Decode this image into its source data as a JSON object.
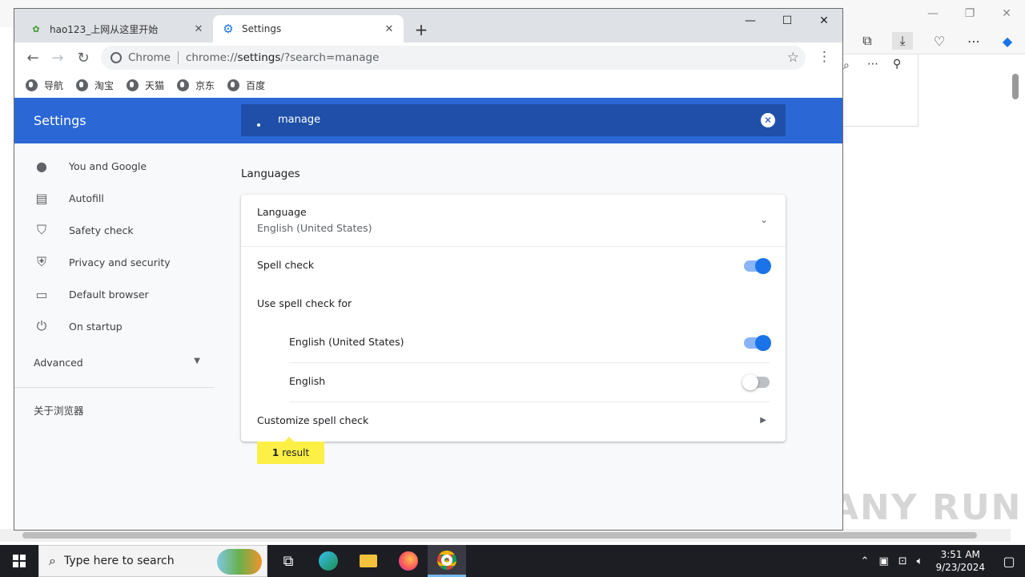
{
  "browser": {
    "tabs": [
      {
        "label": "hao123_上网从这里开始",
        "close": "✕"
      },
      {
        "label": "Settings",
        "close": "✕"
      }
    ],
    "new_tab": "+",
    "window_controls": {
      "minimize": "—",
      "maximize": "☐",
      "close": "✕"
    },
    "omnibox": {
      "chip": "Chrome",
      "url_prefix": "chrome://",
      "url_host": "settings",
      "url_rest": "/?search=manage"
    },
    "bookmarks": [
      "导航",
      "淘宝",
      "天猫",
      "京东",
      "百度"
    ]
  },
  "settings": {
    "title": "Settings",
    "search": {
      "value": "manage",
      "clear_icon": "✕"
    },
    "nav": [
      {
        "label": "You and Google",
        "icon": "person-icon"
      },
      {
        "label": "Autofill",
        "icon": "clipboard-icon"
      },
      {
        "label": "Safety check",
        "icon": "shield-check-icon"
      },
      {
        "label": "Privacy and security",
        "icon": "shield-icon"
      },
      {
        "label": "Default browser",
        "icon": "browser-icon"
      },
      {
        "label": "On startup",
        "icon": "power-icon"
      }
    ],
    "advanced": "Advanced",
    "about": "关于浏览器",
    "section_title": "Languages",
    "language": {
      "label": "Language",
      "value": "English (United States)"
    },
    "spell_check": {
      "label": "Spell check",
      "enabled": true
    },
    "use_spell_check_for": "Use spell check for",
    "spell_languages": [
      {
        "label": "English (United States)",
        "enabled": true
      },
      {
        "label": "English",
        "enabled": false
      }
    ],
    "customize": "Customize spell check",
    "result": {
      "count": "1",
      "label": "result"
    }
  },
  "taskbar": {
    "search_placeholder": "Type here to search",
    "time": "3:51 AM",
    "date": "9/23/2024"
  },
  "watermark": "ANY RUN",
  "colors": {
    "accent": "#2b68d6",
    "toggle_on": "#1a73e8",
    "highlight": "#fcef46"
  }
}
